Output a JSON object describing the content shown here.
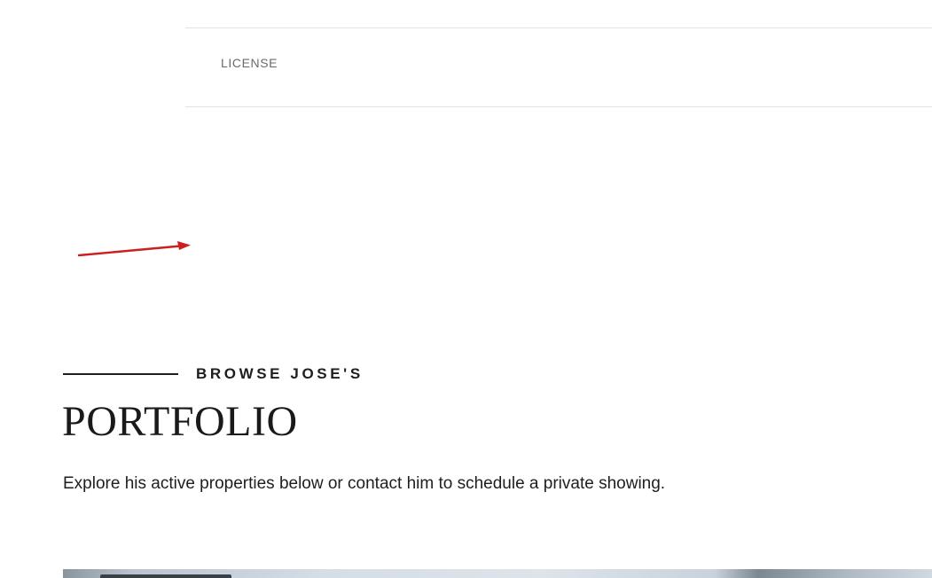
{
  "info_table": {
    "license_label": "LICENSE"
  },
  "portfolio_section": {
    "eyebrow": "BROWSE JOSE'S",
    "title": "PORTFOLIO",
    "description": "Explore his active properties below or contact him to schedule a private showing."
  },
  "annotation": {
    "arrow_color": "#cc1f1f"
  },
  "colors": {
    "text_dark": "#1e1e1e",
    "text_muted": "#6b6b6b",
    "rule": "#e3e3e3"
  }
}
